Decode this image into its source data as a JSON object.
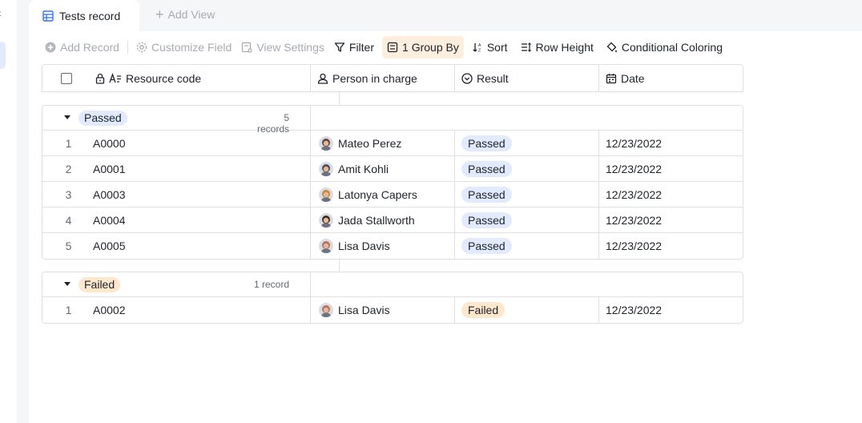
{
  "tabs": {
    "active_label": "Tests record",
    "add_view_label": "Add View"
  },
  "toolbar": {
    "add_record": "Add Record",
    "customize_field": "Customize Field",
    "view_settings": "View Settings",
    "filter": "Filter",
    "group_by": "1 Group By",
    "sort": "Sort",
    "row_height": "Row Height",
    "conditional_coloring": "Conditional Coloring"
  },
  "columns": {
    "resource_code": "Resource code",
    "person_in_charge": "Person in charge",
    "result": "Result",
    "date": "Date"
  },
  "groups": [
    {
      "label": "Passed",
      "count": "5 records",
      "color": "#e1eaff",
      "rows": [
        {
          "idx": "1",
          "code": "A0000",
          "person": "Mateo Perez",
          "result": "Passed",
          "date": "12/23/2022",
          "avatar": "#5b4a3f"
        },
        {
          "idx": "2",
          "code": "A0001",
          "person": "Amit Kohli",
          "result": "Passed",
          "date": "12/23/2022",
          "avatar": "#4a4e5a"
        },
        {
          "idx": "3",
          "code": "A0003",
          "person": "Latonya Capers",
          "result": "Passed",
          "date": "12/23/2022",
          "avatar": "#c9873f"
        },
        {
          "idx": "4",
          "code": "A0004",
          "person": "Jada Stallworth",
          "result": "Passed",
          "date": "12/23/2022",
          "avatar": "#3b2c27"
        },
        {
          "idx": "5",
          "code": "A0005",
          "person": "Lisa Davis",
          "result": "Passed",
          "date": "12/23/2022",
          "avatar": "#b86f6a"
        }
      ]
    },
    {
      "label": "Failed",
      "count": "1 record",
      "color": "#fee7cd",
      "rows": [
        {
          "idx": "1",
          "code": "A0002",
          "person": "Lisa Davis",
          "result": "Failed",
          "date": "12/23/2022",
          "avatar": "#b86f6a"
        }
      ]
    }
  ],
  "colors": {
    "accent": "#3370ff",
    "passed_tag": "#e1eaff",
    "failed_tag": "#fee7cd",
    "group_by_active": "#fdeedd"
  }
}
